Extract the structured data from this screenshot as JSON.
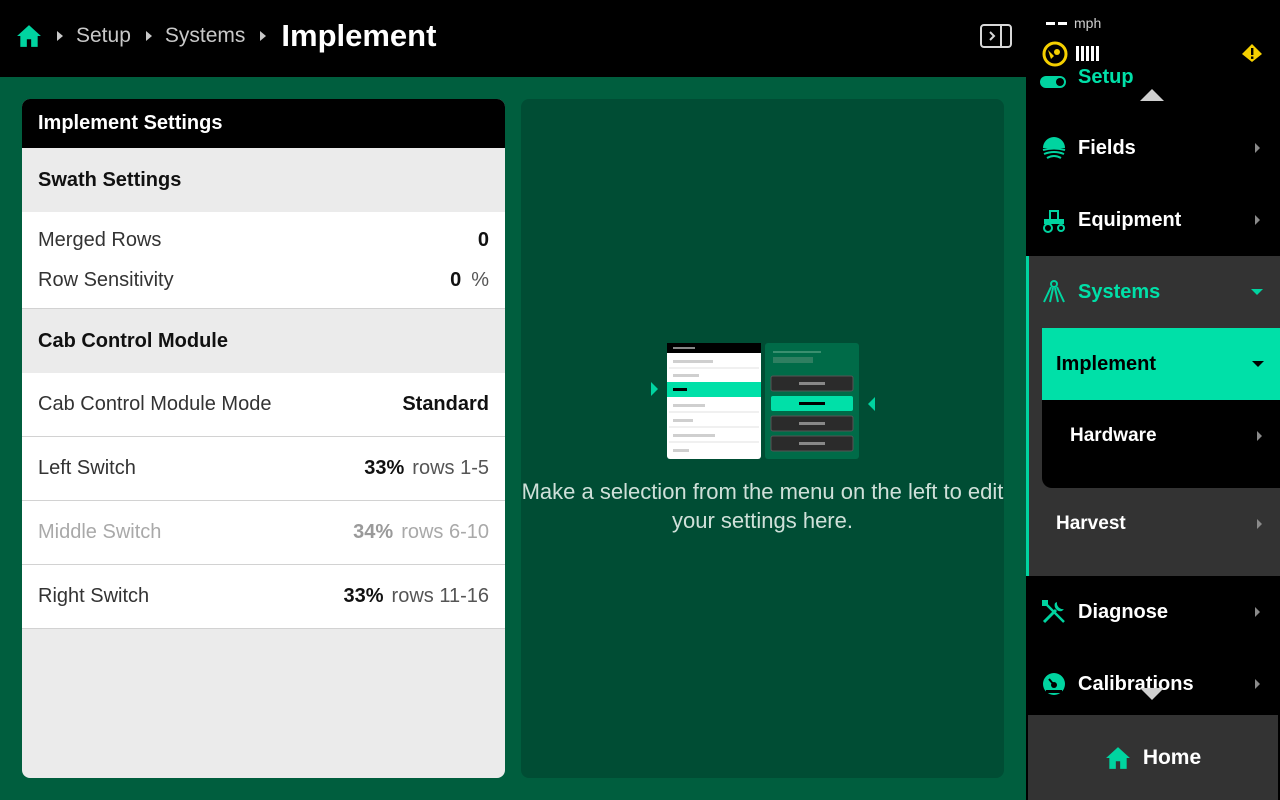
{
  "breadcrumb": {
    "items": [
      "Setup",
      "Systems"
    ],
    "current": "Implement"
  },
  "settings_card": {
    "title": "Implement Settings",
    "swath": {
      "title": "Swath Settings",
      "merged_rows": {
        "label": "Merged Rows",
        "value": "0"
      },
      "row_sensitivity": {
        "label": "Row Sensitivity",
        "value": "0",
        "unit": "%"
      }
    },
    "cab_control": {
      "title": "Cab Control Module",
      "mode": {
        "label": "Cab Control Module Mode",
        "value": "Standard"
      },
      "left_switch": {
        "label": "Left Switch",
        "percent": "33%",
        "rows": "rows 1-5"
      },
      "middle_switch": {
        "label": "Middle Switch",
        "percent": "34%",
        "rows": "rows 6-10"
      },
      "right_switch": {
        "label": "Right Switch",
        "percent": "33%",
        "rows": "rows 11-16"
      }
    }
  },
  "info_panel": {
    "hint": "Make a selection from the menu on the left to edit your settings here."
  },
  "status": {
    "speed_value": "--",
    "speed_unit": "mph"
  },
  "nav": {
    "setup": "Setup",
    "fields": "Fields",
    "equipment": "Equipment",
    "systems": "Systems",
    "implement": "Implement",
    "hardware": "Hardware",
    "harvest": "Harvest",
    "diagnose": "Diagnose",
    "calibrations": "Calibrations",
    "home": "Home"
  },
  "colors": {
    "accent": "#00e0a8",
    "background_green": "#005e3e",
    "panel_green": "#004d34",
    "warning": "#f5d000"
  },
  "icons": {
    "home": "home-icon",
    "panel_toggle": "panel-toggle-icon",
    "gps": "gps-signal-icon",
    "warning": "warning-icon",
    "fields": "fields-icon",
    "equipment": "tractor-icon",
    "systems": "systems-icon",
    "diagnose": "wrench-screwdriver-icon",
    "calibrations": "gauge-icon"
  }
}
